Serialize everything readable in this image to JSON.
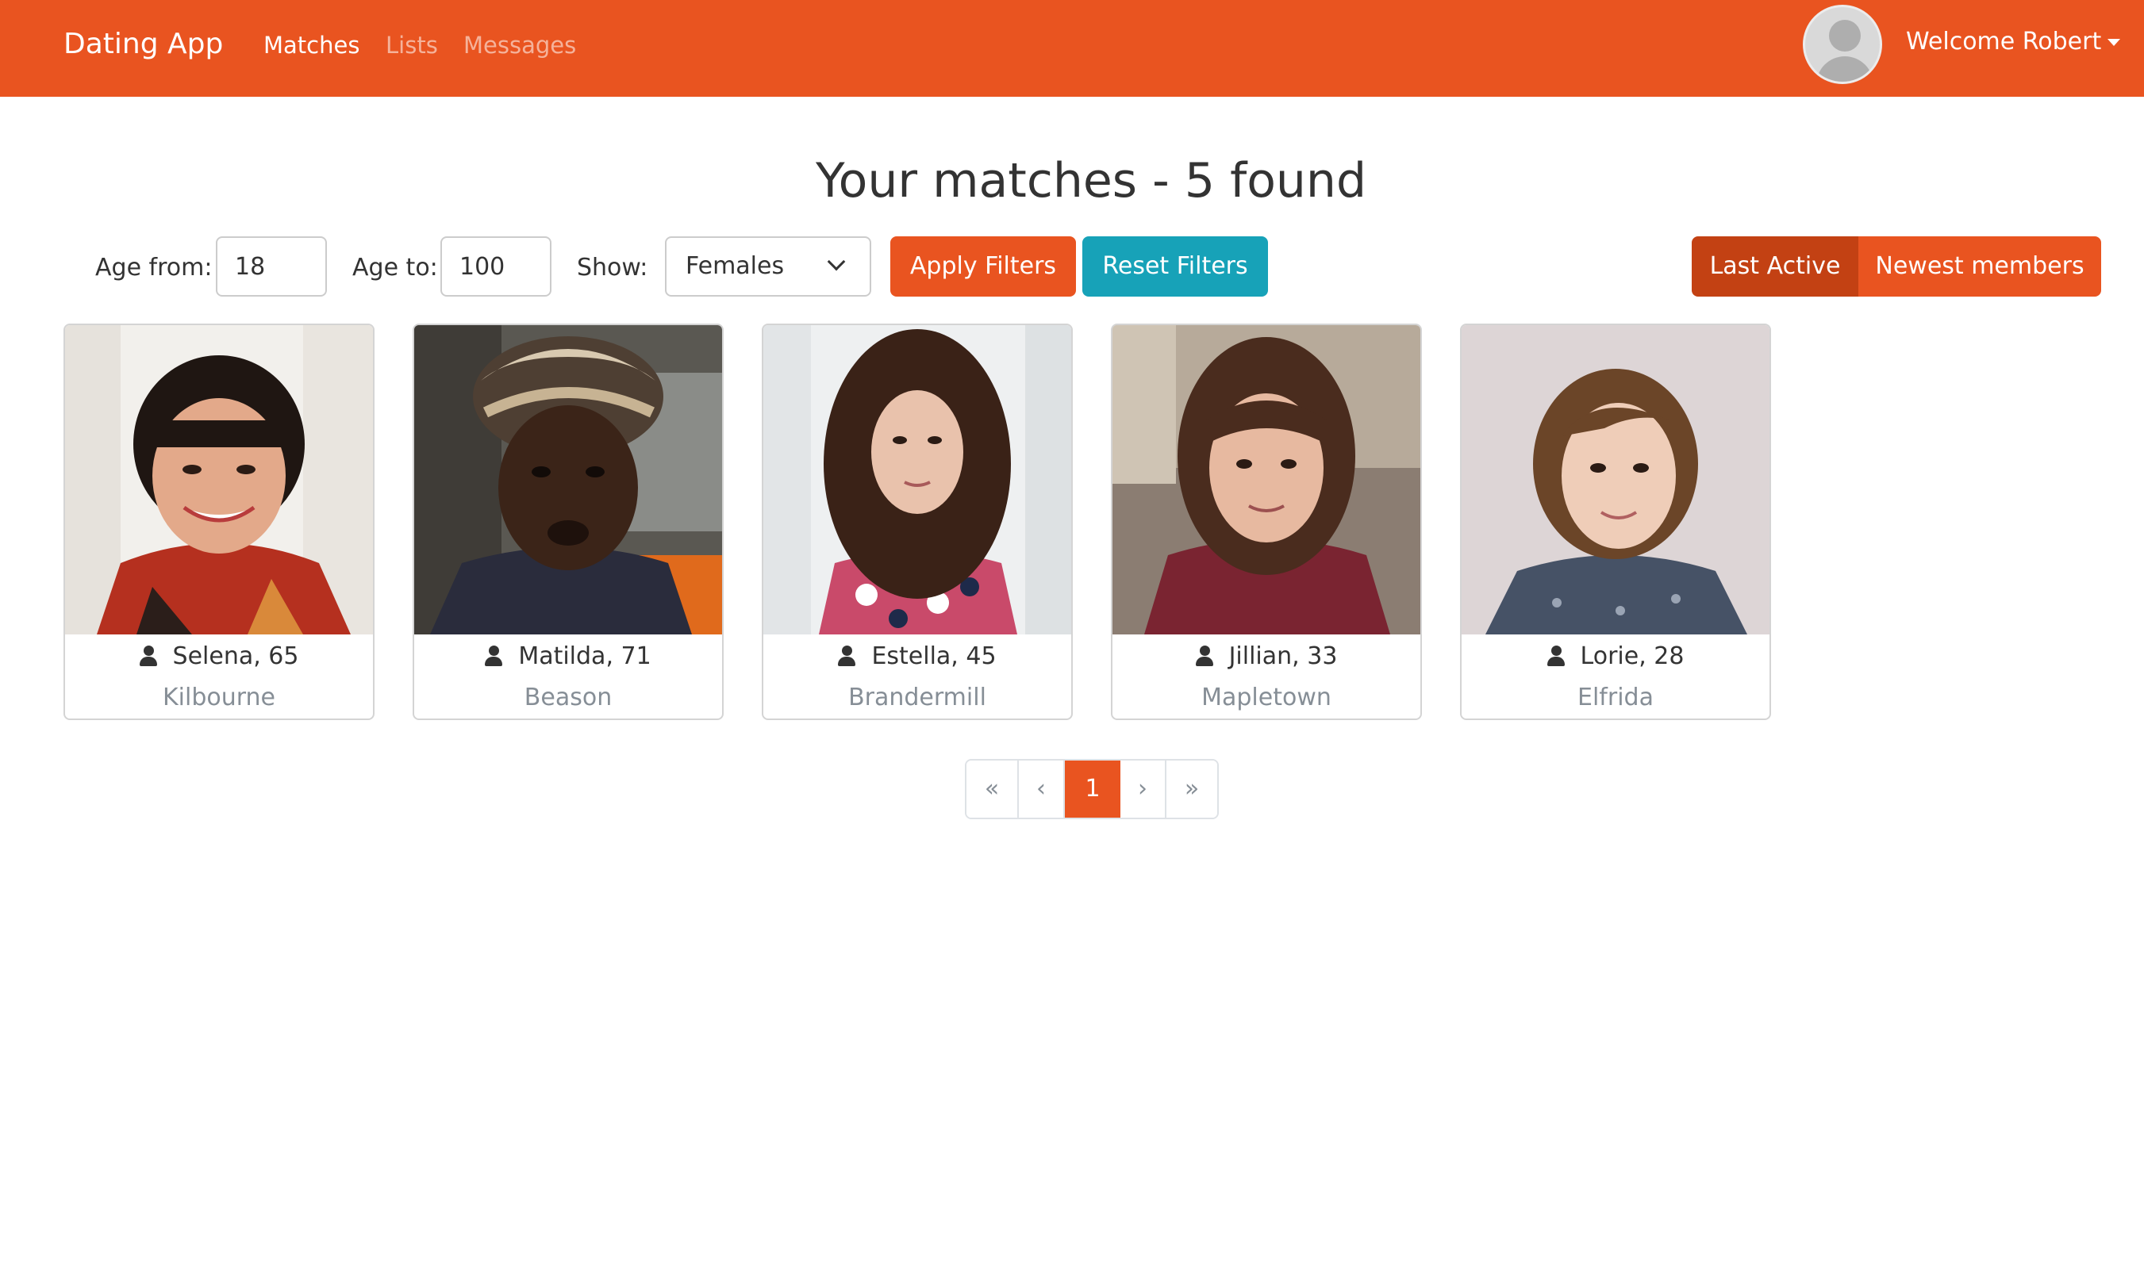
{
  "navbar": {
    "brand": "Dating App",
    "links": [
      {
        "label": "Matches",
        "active": true
      },
      {
        "label": "Lists",
        "active": false
      },
      {
        "label": "Messages",
        "active": false
      }
    ],
    "welcome": "Welcome Robert",
    "avatar_icon": "default-user-avatar"
  },
  "title": "Your matches - 5 found",
  "filters": {
    "age_from_label": "Age from:",
    "age_from_value": "18",
    "age_to_label": "Age to:",
    "age_to_value": "100",
    "show_label": "Show:",
    "show_value": "Females",
    "apply_label": "Apply Filters",
    "reset_label": "Reset Filters"
  },
  "sort": {
    "last_active": "Last Active",
    "newest": "Newest members",
    "selected": "Last Active"
  },
  "matches": [
    {
      "name": "Selena, 65",
      "city": "Kilbourne"
    },
    {
      "name": "Matilda, 71",
      "city": "Beason"
    },
    {
      "name": "Estella, 45",
      "city": "Brandermill"
    },
    {
      "name": "Jillian, 33",
      "city": "Mapletown"
    },
    {
      "name": "Lorie, 28",
      "city": "Elfrida"
    }
  ],
  "pagination": {
    "first": "«",
    "prev": "‹",
    "current": "1",
    "next": "›",
    "last": "»"
  },
  "colors": {
    "primary": "#e95420",
    "primary_dark": "#c34113",
    "info": "#17a2b8",
    "muted": "#868e96"
  }
}
